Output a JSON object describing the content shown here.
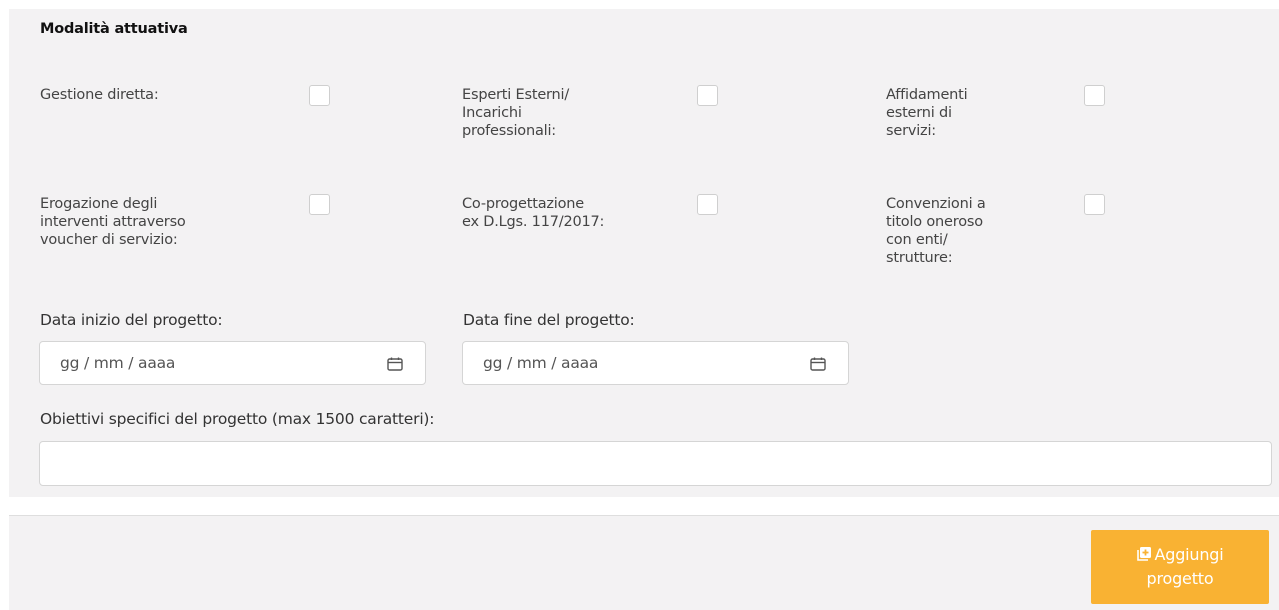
{
  "section": {
    "title": "Modalità attuativa"
  },
  "options": [
    {
      "label": "Gestione diretta:",
      "checked": false
    },
    {
      "label": "Esperti Esterni/\nIncarichi\nprofessionali:",
      "checked": false
    },
    {
      "label": "Affidamenti\nesterni di\nservizi:",
      "checked": false
    },
    {
      "label": "Erogazione degli\ninterventi attraverso\nvoucher di servizio:",
      "checked": false
    },
    {
      "label": "Co-progettazione\nex D.Lgs. 117/2017:",
      "checked": false
    },
    {
      "label": "Convenzioni a\ntitolo oneroso\ncon enti/\nstrutture:",
      "checked": false
    }
  ],
  "start_date": {
    "label": "Data inizio del progetto:",
    "placeholder": "gg / mm / aaaa",
    "icon": "calendar-icon"
  },
  "end_date": {
    "label": "Data fine del progetto:",
    "placeholder": "gg / mm / aaaa",
    "icon": "calendar-icon"
  },
  "objectives": {
    "label": "Obiettivi specifici del progetto (max 1500 caratteri):",
    "value": ""
  },
  "add_button": {
    "label_line1": "Aggiungi",
    "label_line2": "progetto",
    "icon": "plus-square-icon",
    "color": "#f9b233"
  }
}
